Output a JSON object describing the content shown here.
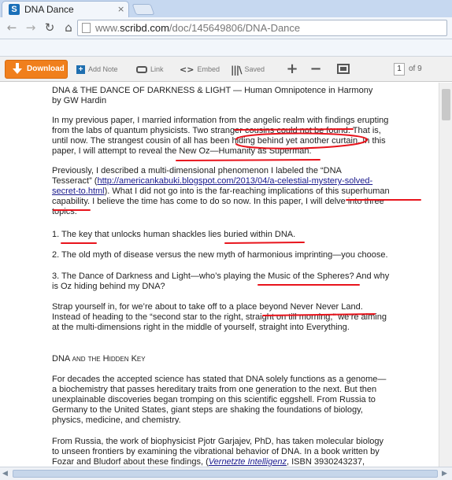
{
  "browser": {
    "tab_title": "DNA Dance",
    "tab_close": "×",
    "favicon_letter": "S",
    "url_prefix": "www.",
    "url_host": "scribd.com",
    "url_path": "/doc/145649806/DNA-Dance",
    "icons": {
      "back": "←",
      "forward": "→",
      "reload": "↻",
      "home": "⌂"
    }
  },
  "toolbar": {
    "download_label": "Download",
    "add_note_label": "Add Note",
    "link_label": "Link",
    "embed_label": "Embed",
    "embed_icon": "<>",
    "saved_label": "Saved",
    "saved_icon": "|||\\",
    "zoom_in": "+",
    "zoom_out": "−",
    "page_current": "1",
    "page_total": "of 9",
    "accent_color": "#f07f1c"
  },
  "document": {
    "title_line": "DNA & THE DANCE OF DARKNESS & LIGHT — Human Omnipotence in Harmony",
    "byline": "by GW Hardin",
    "p1": {
      "l1": "In my previous paper, I married information from the angelic realm with findings erupting",
      "l2": "from the labs of quantum physicists. Two stranger cousins could not be found. That is,",
      "l3": "until now. The strangest cousin of all has been hiding behind yet another curtain. In this",
      "l4": "paper, I will attempt to reveal the New Oz—Humanity as Superman."
    },
    "p2": {
      "l1": "Previously, I described a multi-dimensional phenomenon I labeled the “DNA",
      "l2a": "Tesseract” (",
      "l2_link": "http://americankabuki.blogspot.com/2013/04/a-celestial-mystery-solved-",
      "l3_link": "secret-to.html",
      "l3b": "). What I did not go into is the far-reaching implications of this superhuman",
      "l4": "capability. I believe the time has come to do so now. In this paper, I will delve into three",
      "l5": "topics:"
    },
    "item1": "1. The key that unlocks human shackles lies buried within DNA.",
    "item2": "2. The old myth of disease versus the new myth of harmonious imprinting—you choose.",
    "item3": {
      "l1": "3. The Dance of Darkness and Light—who’s playing the Music of the Spheres? And why",
      "l2": "is Oz hiding behind my DNA?"
    },
    "p3": {
      "l1": "Strap yourself in, for we’re about to take off to a place beyond Never Never Land.",
      "l2": "Instead of heading to the “second star to the right, straight on till morning,” we’re aiming",
      "l3": "at the multi-dimensions right in the middle of yourself, straight into Everything."
    },
    "section_heading": "DNA and the Hidden Key",
    "p4": {
      "l1": "For decades the accepted science has stated that DNA solely functions as a genome—",
      "l2": "a biochemistry that passes hereditary traits from one generation to the next. But then",
      "l3": "unexplainable discoveries began tromping on this scientific eggshell. From Russia to",
      "l4": "Germany to the United States, giant steps are shaking the foundations of biology,",
      "l5": "physics, medicine, and chemistry."
    },
    "p5": {
      "l1": "From Russia, the work of biophysicist Pjotr Garjajev, PhD, has taken molecular biology",
      "l2": "to unseen frontiers by examining the vibrational behavior of DNA. In a book written by",
      "l3a": "Fozar and Bludorf about these findings, (",
      "l3_ital": "Vernetzte Intelligenz",
      "l3b": ", ISBN 3930243237,"
    },
    "annotation_color": "#e8141c"
  }
}
